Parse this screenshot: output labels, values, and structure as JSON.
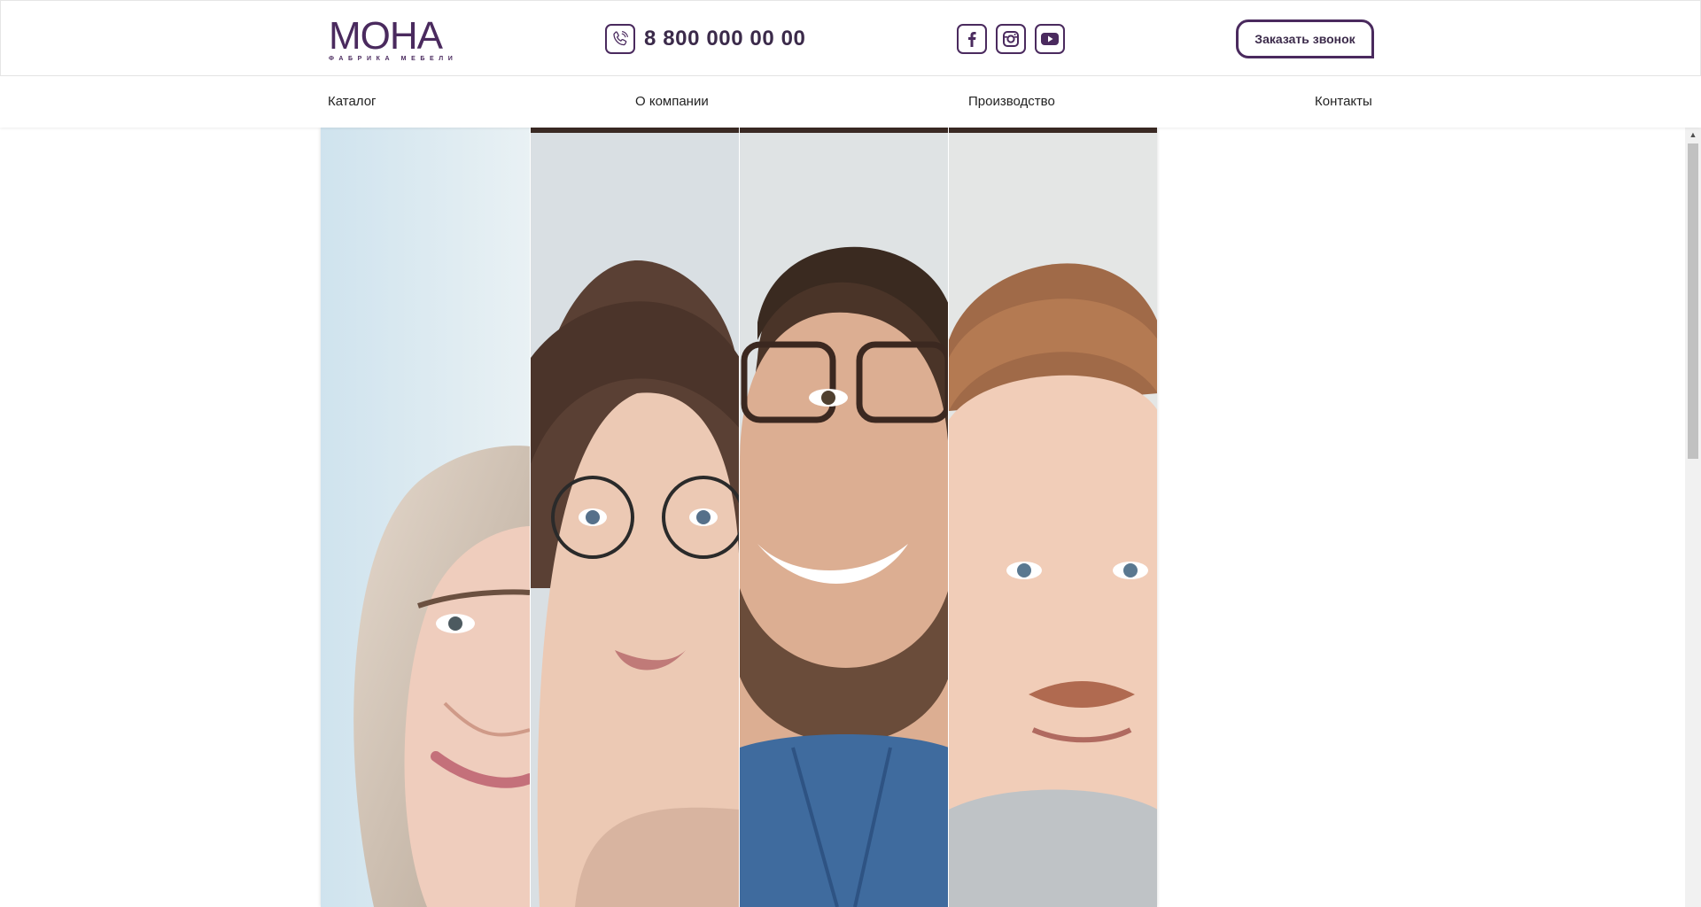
{
  "logo": {
    "main": "МОНА",
    "sub": "ФАБРИКА МЕБЕЛИ"
  },
  "header": {
    "phone": "8 800 000 00 00",
    "callback_label": "Заказать звонок",
    "social": [
      "facebook-icon",
      "instagram-icon",
      "youtube-icon"
    ]
  },
  "nav": {
    "items": [
      {
        "label": "Каталог"
      },
      {
        "label": "О компании"
      },
      {
        "label": "Производство"
      },
      {
        "label": "Контакты"
      }
    ]
  },
  "hero": {
    "panels": [
      "portrait-woman-blonde",
      "portrait-woman-glasses",
      "portrait-man-beard-glasses",
      "portrait-man-redhead"
    ]
  },
  "colors": {
    "brand": "#4a2a5e",
    "text": "#222222",
    "border": "#e6e6e6"
  },
  "scrollbar": {
    "up_arrow": "▲"
  }
}
